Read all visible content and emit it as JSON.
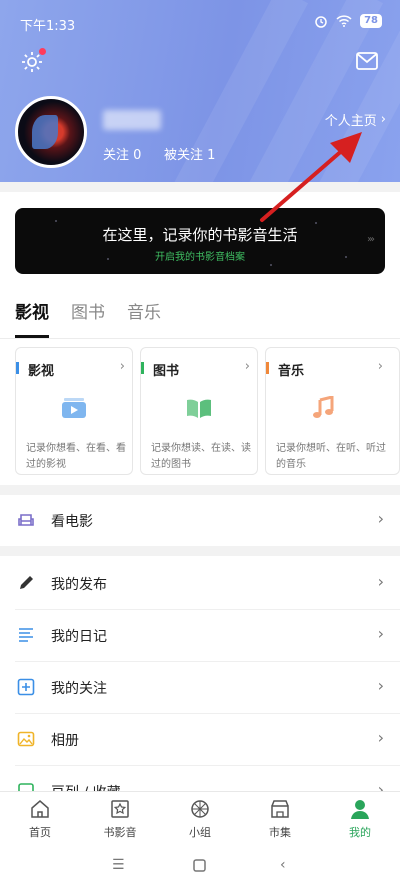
{
  "status_bar": {
    "time": "下午1:33",
    "battery": "78"
  },
  "profile": {
    "follow_label": "关注 0",
    "followers_label": "被关注 1",
    "homepage_label": "个人主页"
  },
  "banner": {
    "title": "在这里，记录你的书影音生活",
    "subtitle": "开启我的书影音档案"
  },
  "tabs": [
    {
      "label": "影视",
      "active": true
    },
    {
      "label": "图书",
      "active": false
    },
    {
      "label": "音乐",
      "active": false
    }
  ],
  "cards": [
    {
      "title": "影视",
      "desc": "记录你想看、在看、看过的影视",
      "accent": "#3b8fe6",
      "icon": "film-icon"
    },
    {
      "title": "图书",
      "desc": "记录你想读、在读、读过的图书",
      "accent": "#2fb35d",
      "icon": "book-icon"
    },
    {
      "title": "音乐",
      "desc": "记录你想听、在听、听过的音乐",
      "accent": "#f0883a",
      "icon": "music-note-icon"
    }
  ],
  "menu": [
    {
      "label": "看电影",
      "icon": "cinema-seat-icon"
    },
    {
      "label": "我的发布",
      "icon": "pencil-icon"
    },
    {
      "label": "我的日记",
      "icon": "diary-lines-icon"
    },
    {
      "label": "我的关注",
      "icon": "plus-box-icon"
    },
    {
      "label": "相册",
      "icon": "photo-icon"
    },
    {
      "label": "豆列 / 收藏",
      "icon": "collection-icon"
    }
  ],
  "bottom_nav": [
    {
      "label": "首页",
      "active": false
    },
    {
      "label": "书影音",
      "active": false
    },
    {
      "label": "小组",
      "active": false
    },
    {
      "label": "市集",
      "active": false
    },
    {
      "label": "我的",
      "active": true
    }
  ],
  "colors": {
    "header": "#7d94e6",
    "active_green": "#2aa55b",
    "annotation_red": "#d62020"
  }
}
